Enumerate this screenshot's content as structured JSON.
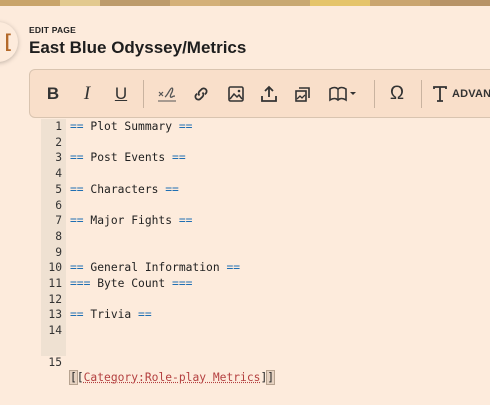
{
  "header": {
    "eyebrow": "EDIT PAGE",
    "title": "East Blue Odyssey/Metrics"
  },
  "toolbar": {
    "bold": "B",
    "italic": "I",
    "underline": "U",
    "advanced": "ADVAN",
    "icons": [
      "bold-icon",
      "italic-icon",
      "underline-icon",
      "signature-icon",
      "link-icon",
      "image-icon",
      "upload-icon",
      "gallery-icon",
      "book-template-icon",
      "omega-icon",
      "text-format-icon"
    ]
  },
  "editor": {
    "lines": [
      {
        "n": "1",
        "open": "==",
        "text": " Plot Summary ",
        "close": "=="
      },
      {
        "n": "2",
        "open": "",
        "text": "",
        "close": ""
      },
      {
        "n": "3",
        "open": "==",
        "text": " Post Events ",
        "close": "=="
      },
      {
        "n": "4",
        "open": "",
        "text": "",
        "close": ""
      },
      {
        "n": "5",
        "open": "==",
        "text": " Characters ",
        "close": "=="
      },
      {
        "n": "6",
        "open": "",
        "text": "",
        "close": ""
      },
      {
        "n": "7",
        "open": "==",
        "text": " Major Fights ",
        "close": "=="
      },
      {
        "n": "8",
        "open": "",
        "text": "",
        "close": ""
      },
      {
        "n": "9",
        "open": "",
        "text": "",
        "close": ""
      },
      {
        "n": "10",
        "open": "==",
        "text": " General Information ",
        "close": "=="
      },
      {
        "n": "11",
        "open": "===",
        "text": " Byte Count ",
        "close": "==="
      },
      {
        "n": "12",
        "open": "",
        "text": "",
        "close": ""
      },
      {
        "n": "13",
        "open": "==",
        "text": " Trivia ",
        "close": "=="
      },
      {
        "n": "14",
        "open": "",
        "text": "",
        "close": ""
      }
    ],
    "last_line": {
      "n": "15",
      "open_bracket": "[",
      "open_inner": "[",
      "link": "Category:Role-play Metrics",
      "close_inner": "]",
      "close_bracket": "]"
    }
  },
  "colors": {
    "background": "#fdebdc",
    "heading_markup": "#1f6fb3",
    "link": "#b44040",
    "accent": "#b4692a"
  }
}
